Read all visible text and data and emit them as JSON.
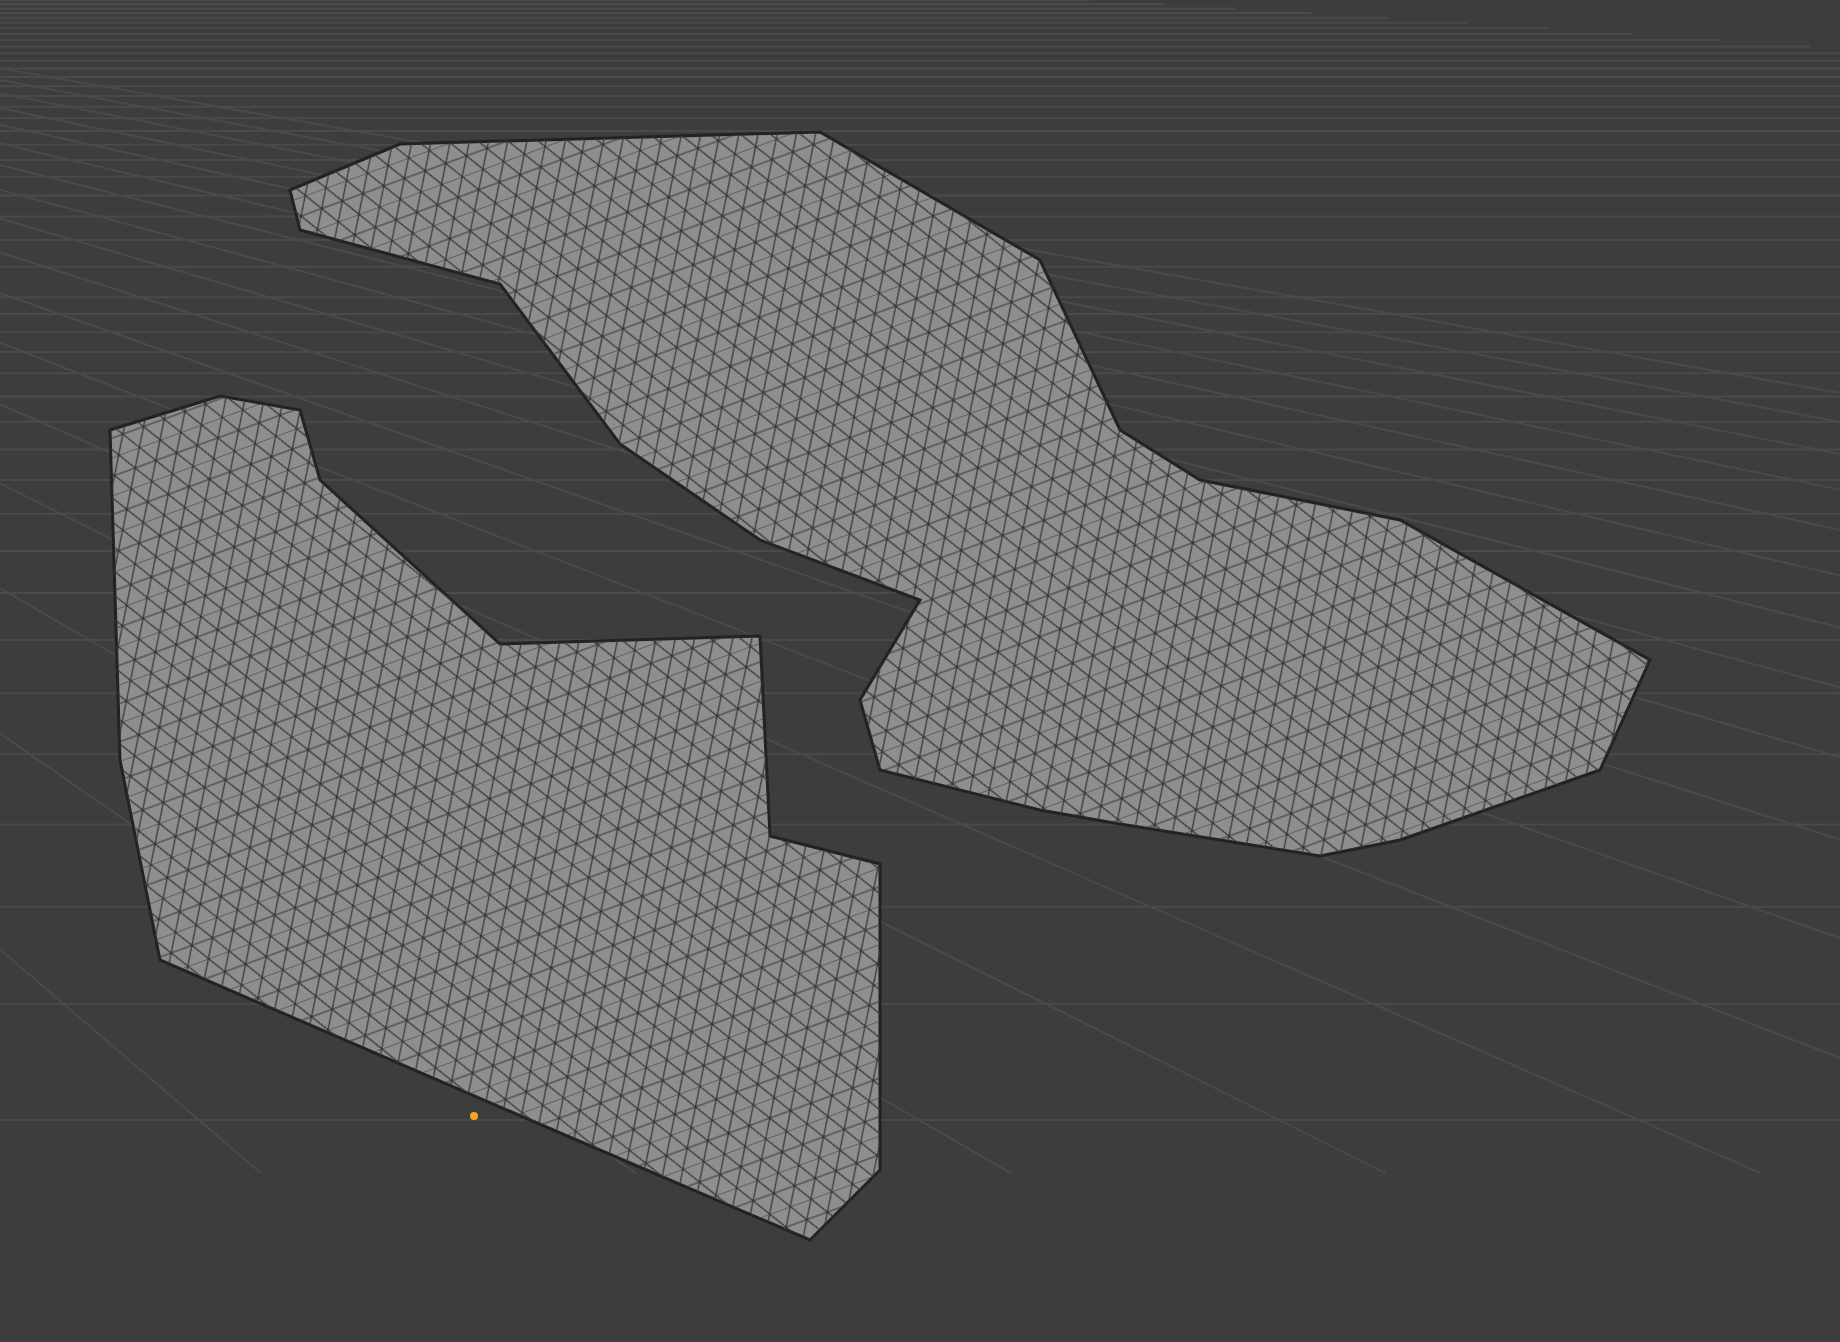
{
  "viewport": {
    "show_grid": true,
    "origin_visible": true
  }
}
